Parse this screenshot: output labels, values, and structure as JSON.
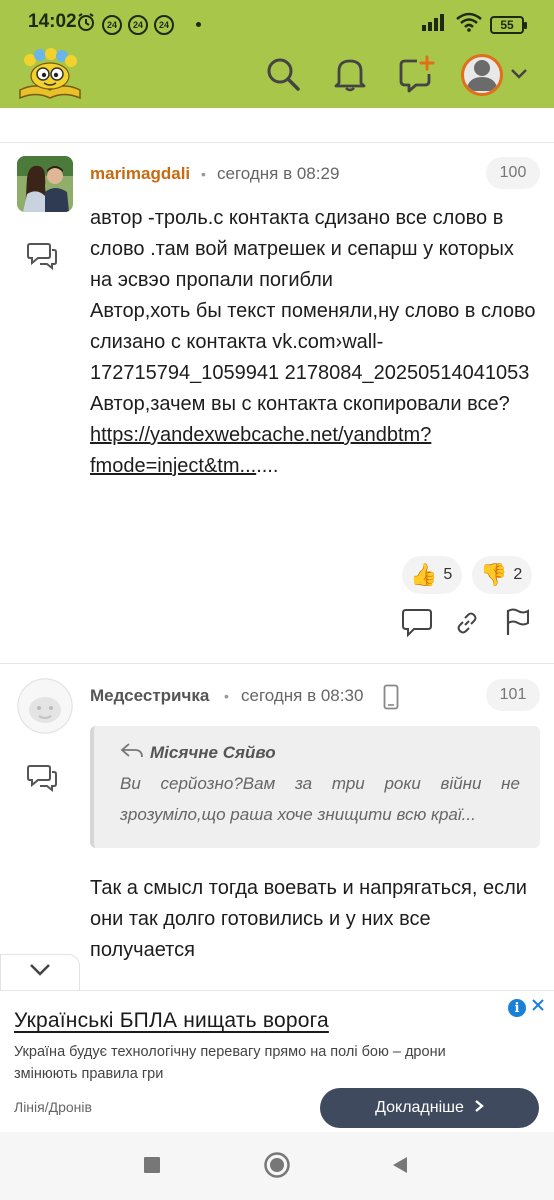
{
  "status_bar": {
    "time": "14:02",
    "notif_badges": [
      "24",
      "24",
      "24"
    ],
    "battery": "55",
    "icons": [
      "alarm-icon",
      "signal-icon",
      "wifi-icon",
      "battery-icon"
    ]
  },
  "header": {
    "icons": [
      "logo-icon",
      "search-icon",
      "bell-icon",
      "new-message-icon",
      "avatar-icon",
      "chevron-down-icon"
    ],
    "accent_color": "#a7c64a",
    "avatar_ring_color": "#e36e1a"
  },
  "comments": [
    {
      "author": "marimagdali",
      "author_color": "#c76a12",
      "separator": "•",
      "date": "сегодня в 08:29",
      "number": "100",
      "text_lines": [
        "автор -троль.с контакта сдизано все слово в слово .там вой матрешек и сепарш у которых на эсвэо пропали погибли",
        "Автор,хоть бы текст поменяли,ну слово в слово слизано с контакта vk.com›wall-172715794_1059941 2178084_20250514041053",
        "Автор,зачем вы с контакта скопировали все?"
      ],
      "link_text": "https://yandexwebcache.net/yandbtm?fmode=inject&tm...",
      "link_suffix": "....",
      "likes": "5",
      "dislikes": "2",
      "action_icons": [
        "reply-icon",
        "link-icon",
        "flag-icon"
      ]
    },
    {
      "author": "Медсестричка",
      "author_color": "#555555",
      "separator": "•",
      "date": "сегодня в 08:30",
      "number": "101",
      "quote_author": "Місячне Сяйво",
      "quote_text": "Ви серйозно?Вам за три роки війни не зрозуміло,що раша хоче знищити всю краї...",
      "text": "Так а смысл тогда воевать и напрягаться, если они так долго готовились и у них все получается"
    }
  ],
  "ad": {
    "title": "Українські БПЛА нищать ворога",
    "description": "Україна будує технологічну перевагу прямо на полі бою – дрони змінюють правила гри",
    "source": "Лінія/Дронів",
    "button_label": "Докладніше",
    "info_label": "i"
  },
  "navbar": {
    "icons": [
      "recents-icon",
      "home-icon",
      "back-icon"
    ]
  }
}
